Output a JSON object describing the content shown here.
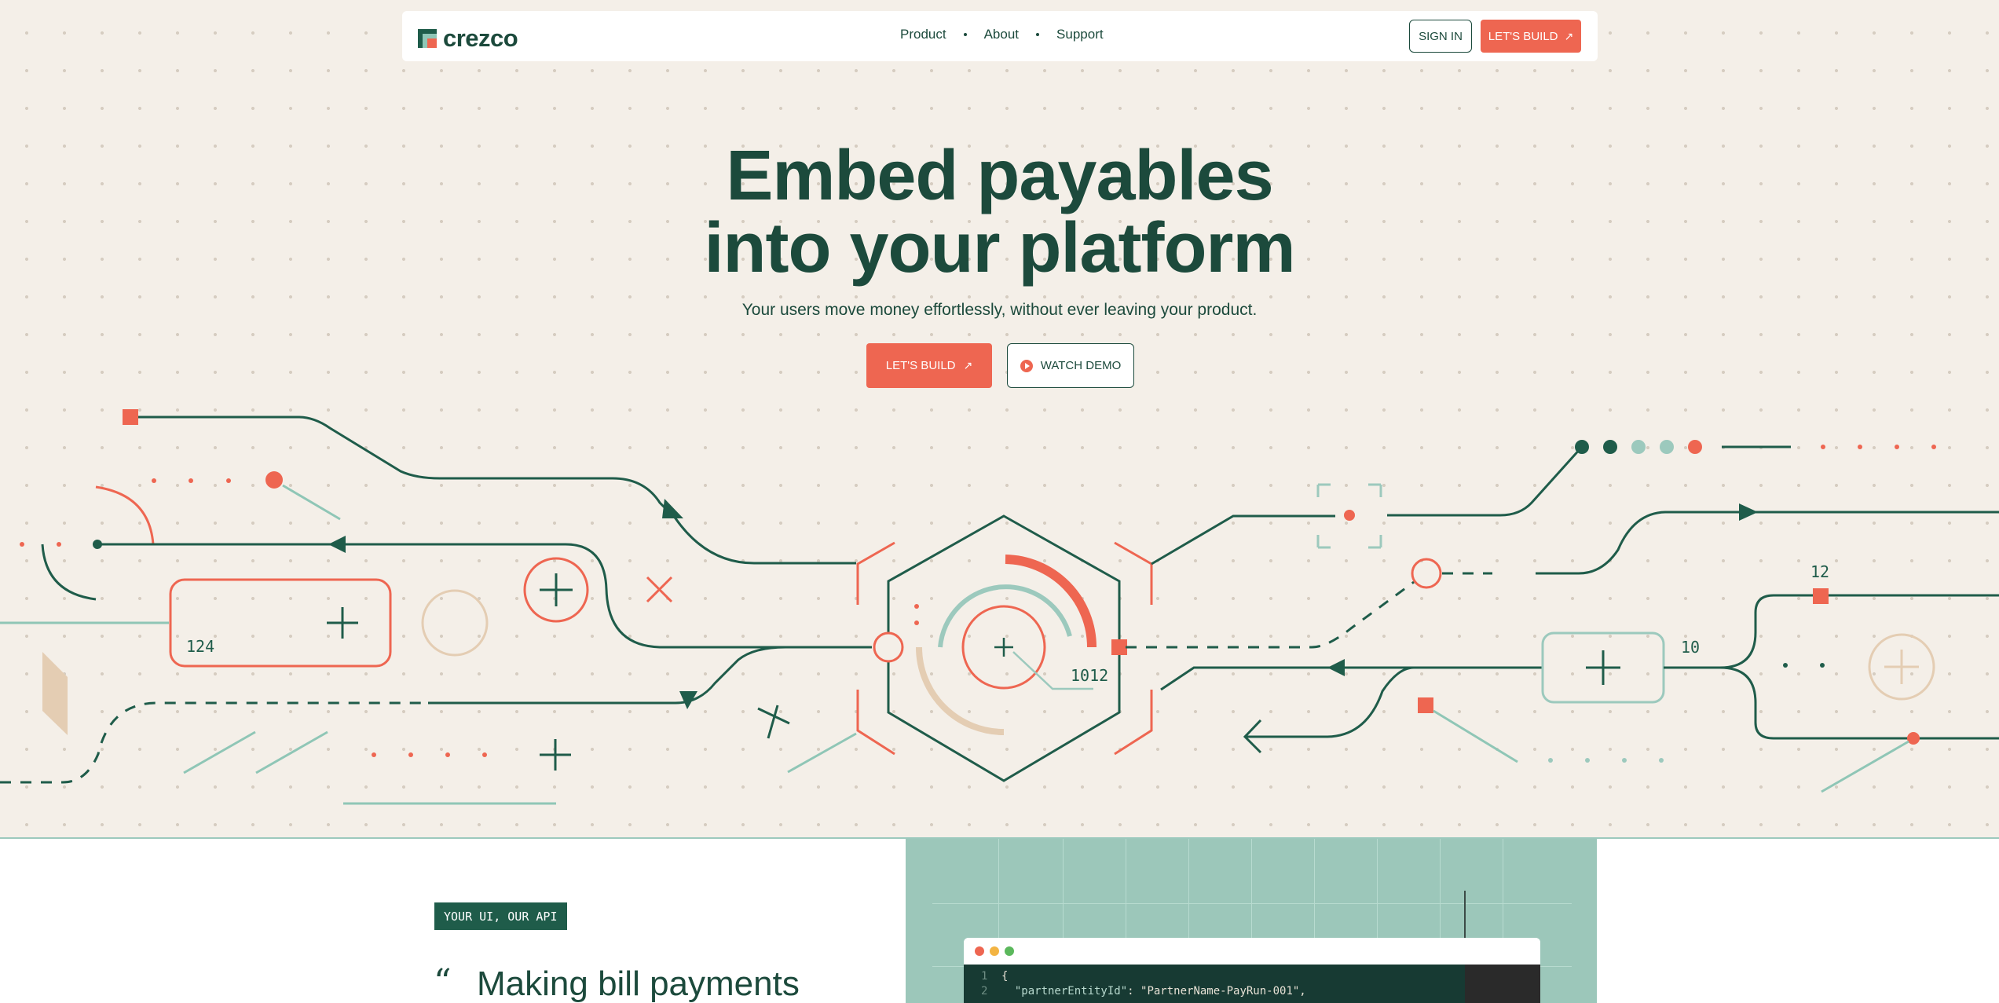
{
  "nav": {
    "logo_text": "crezco",
    "links": [
      "Product",
      "About",
      "Support"
    ],
    "signin_label": "SIGN IN",
    "cta_label": "LET'S BUILD",
    "cta_arrow": "↗"
  },
  "hero": {
    "title_line1": "Embed payables",
    "title_line2": "into your platform",
    "subtitle": "Your users move money effortlessly, without ever leaving your product.",
    "primary_button": "LET'S BUILD",
    "primary_arrow": "↗",
    "secondary_button": "WATCH DEMO"
  },
  "illustration": {
    "labels": [
      "124",
      "1012",
      "12",
      "10"
    ]
  },
  "section": {
    "tag": "YOUR UI, OUR API",
    "quote_mark": "“",
    "quote": "Making bill payments",
    "code": {
      "line1_no": "1",
      "line1": "{",
      "line2_no": "2",
      "line2_key": "\"partnerEntityId\"",
      "line2_rest": ": \"PartnerName-PayRun-001\","
    }
  },
  "colors": {
    "background": "#f4efe8",
    "brand_dark": "#1c4a3c",
    "coral": "#ee6651",
    "mint": "#8fc6b6",
    "sand": "#e4cdb3"
  }
}
